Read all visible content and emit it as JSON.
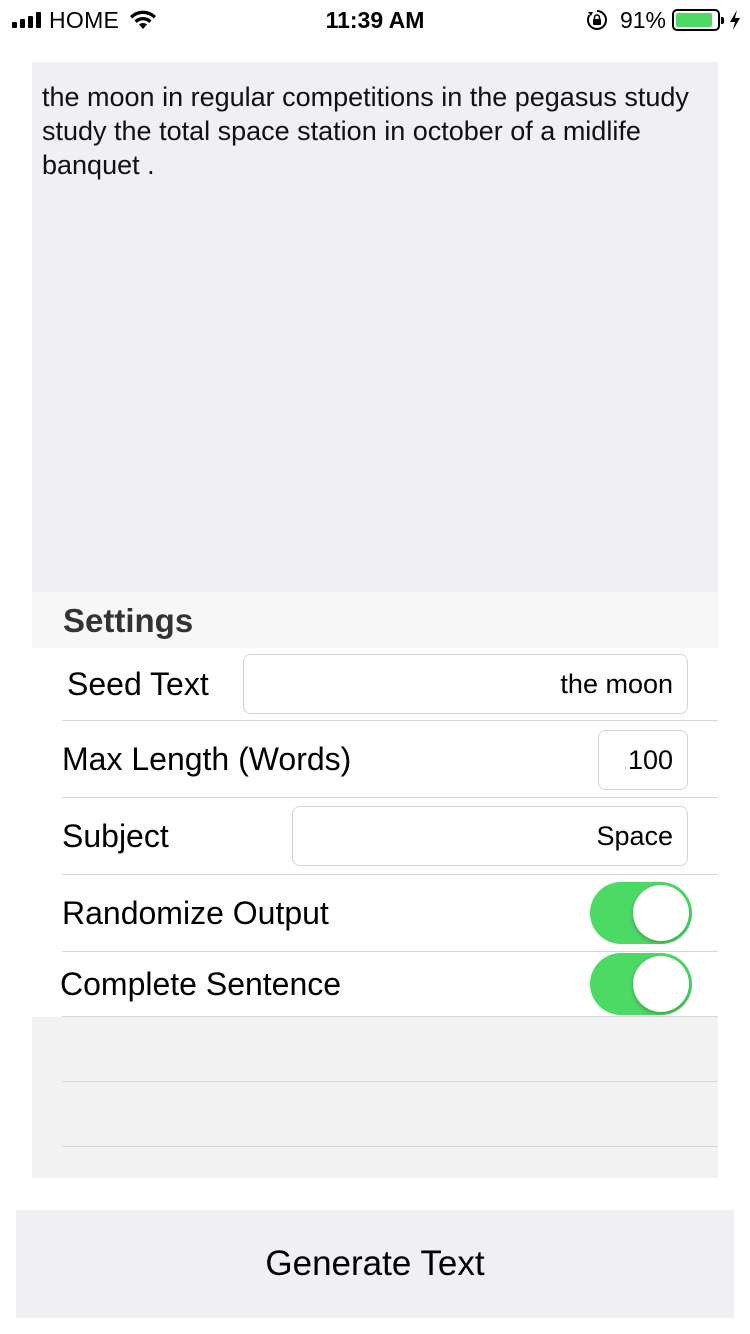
{
  "status_bar": {
    "carrier": "HOME",
    "time": "11:39 AM",
    "battery_percent": "91%",
    "battery_level": 0.91,
    "icons": [
      "signal-bars-icon",
      "wifi-icon",
      "orientation-lock-icon",
      "battery-icon",
      "charging-bolt-icon"
    ]
  },
  "output": {
    "text": "the moon in regular competitions in the pegasus study study the total space station in october of a midlife banquet ."
  },
  "settings": {
    "title": "Settings",
    "seed_text": {
      "label": "Seed Text",
      "value": "the moon"
    },
    "max_length": {
      "label": "Max Length (Words)",
      "value": "100"
    },
    "subject": {
      "label": "Subject",
      "value": "Space"
    },
    "randomize": {
      "label": "Randomize Output",
      "on": true
    },
    "complete_sentence": {
      "label": "Complete Sentence",
      "on": true
    }
  },
  "generate_button": {
    "label": "Generate Text"
  },
  "colors": {
    "toggle_on": "#4cd964",
    "output_background": "#efeff4",
    "table_background": "#f2f2f2",
    "button_background": "#efeff4"
  }
}
